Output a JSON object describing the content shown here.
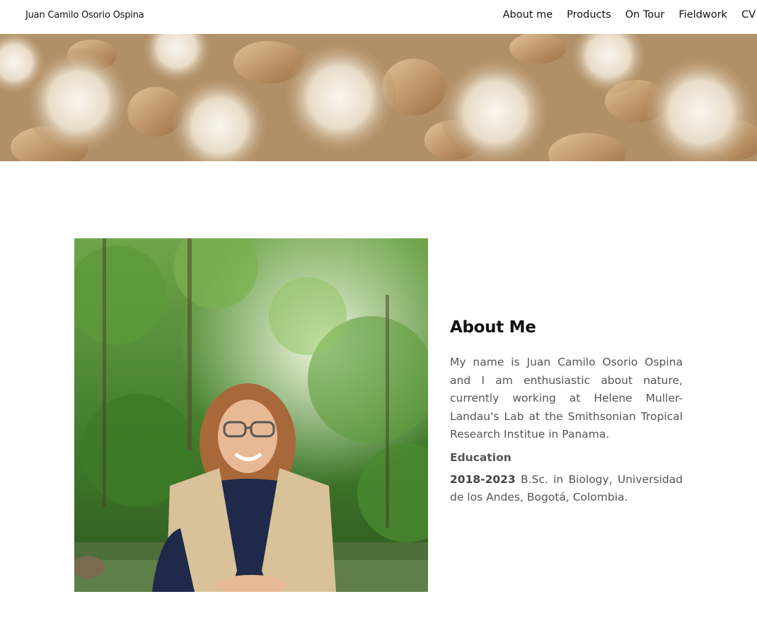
{
  "header": {
    "site_title": "Juan Camilo Osorio Ospina",
    "nav": [
      "About me",
      "Products",
      "On Tour",
      "Fieldwork",
      "CV"
    ]
  },
  "banner": {
    "description_icon": "seed-fibers-banner"
  },
  "about": {
    "heading": "About Me",
    "bio": "My name is Juan Camilo Osorio Ospina and I am enthusiastic about nature, currently working at Helene Muller-Landau's Lab at the Smithsonian Tropical Research Institue in Panama.",
    "education_title": "Education",
    "education": [
      {
        "years": "2018-2023",
        "detail": " B.Sc. in Biology, Universidad de los Andes, Bogotá, Colombia."
      }
    ]
  },
  "colors": {
    "text_dark": "#111111",
    "text_body": "#555555",
    "banner_base": "#cdb08a",
    "photo_green": "#4f8a34"
  }
}
